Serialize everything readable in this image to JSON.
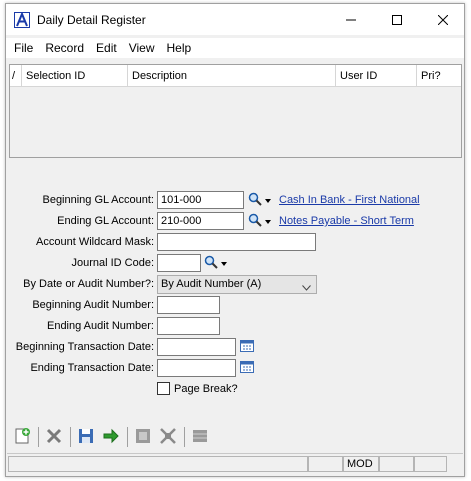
{
  "window": {
    "title": "Daily Detail Register",
    "controls": {
      "minimize": "–",
      "maximize": "☐",
      "close": "✕"
    }
  },
  "menu": [
    "File",
    "Record",
    "Edit",
    "View",
    "Help"
  ],
  "grid": {
    "columns": [
      "Selection ID",
      "Description",
      "User ID",
      "Pri?"
    ],
    "marker": "/"
  },
  "form": {
    "beginning_gl_account": {
      "label": "Beginning GL Account:",
      "value": "101-000",
      "link": "Cash In Bank - First National"
    },
    "ending_gl_account": {
      "label": "Ending GL Account:",
      "value": "210-000",
      "link": "Notes Payable - Short Term"
    },
    "account_wildcard_mask": {
      "label": "Account Wildcard Mask:",
      "value": ""
    },
    "journal_id_code": {
      "label": "Journal ID Code:",
      "value": ""
    },
    "by_date_or_audit": {
      "label": "By Date or Audit Number?:",
      "value": "By Audit Number (A)"
    },
    "beginning_audit_number": {
      "label": "Beginning Audit Number:",
      "value": ""
    },
    "ending_audit_number": {
      "label": "Ending Audit Number:",
      "value": ""
    },
    "beginning_transaction_date": {
      "label": "Beginning Transaction Date:",
      "value": ""
    },
    "ending_transaction_date": {
      "label": "Ending Transaction Date:",
      "value": ""
    },
    "page_break": {
      "label": "Page Break?",
      "checked": false
    }
  },
  "toolbar": [
    "new-icon",
    "delete-icon",
    "save-icon",
    "run-icon",
    "first-icon",
    "expand-icon",
    "list-icon"
  ],
  "status": {
    "mode": "MOD"
  },
  "colors": {
    "link": "#1a3aa8",
    "accent": "#1a3aa8"
  }
}
